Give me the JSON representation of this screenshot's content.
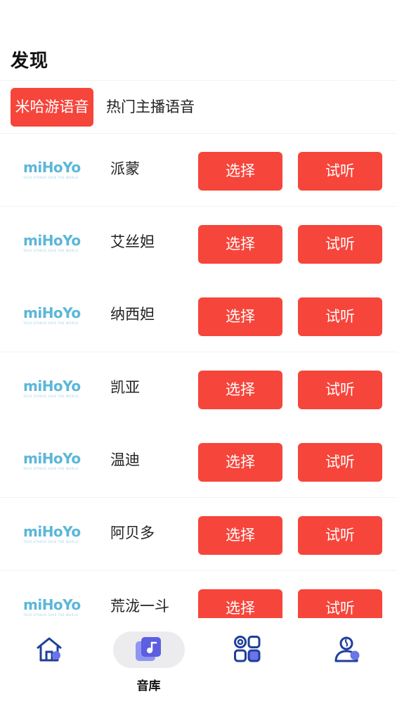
{
  "header": {
    "title": "发现"
  },
  "tabs": [
    {
      "label": "米哈游语音",
      "active": true
    },
    {
      "label": "热门主播语音",
      "active": false
    }
  ],
  "logo": {
    "word": "miHoYo",
    "tagline": "TECH OTAKUS SAVE THE WORLD"
  },
  "list": {
    "select_label": "选择",
    "listen_label": "试听",
    "items": [
      {
        "name": "派蒙"
      },
      {
        "name": "艾丝妲"
      },
      {
        "name": "纳西妲"
      },
      {
        "name": "凯亚"
      },
      {
        "name": "温迪"
      },
      {
        "name": "阿贝多"
      },
      {
        "name": "荒泷一斗"
      }
    ]
  },
  "bottom_nav": [
    {
      "icon": "home-icon",
      "label": ""
    },
    {
      "icon": "music-library-icon",
      "label": "音库",
      "active": true
    },
    {
      "icon": "apps-icon",
      "label": ""
    },
    {
      "icon": "profile-icon",
      "label": ""
    }
  ],
  "colors": {
    "accent": "#f6453b",
    "icon_dark": "#1f3f9a",
    "icon_light": "#6b74e8",
    "logo": "#5bb7d8"
  }
}
